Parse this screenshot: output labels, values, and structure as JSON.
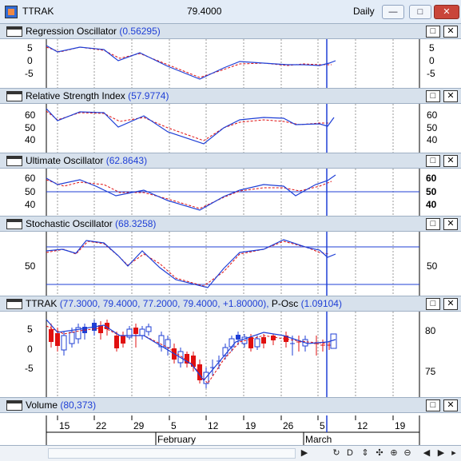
{
  "window": {
    "symbol": "TTRAK",
    "price": "79.4000",
    "period": "Daily"
  },
  "panels": {
    "regression": {
      "name": "Regression Oscillator",
      "value": "(0.56295)",
      "ticks": [
        "5",
        "0",
        "-5"
      ]
    },
    "rsi": {
      "name": "Relative Strength Index",
      "value": "(57.9774)",
      "ticks": [
        "60",
        "50",
        "40"
      ]
    },
    "ultimate": {
      "name": "Ultimate Oscillator",
      "value": "(62.8643)",
      "ticks": [
        "60",
        "50",
        "40"
      ]
    },
    "stochastic": {
      "name": "Stochastic Oscillator",
      "value": "(68.3258)",
      "ticks": [
        "50"
      ]
    },
    "price": {
      "name": "TTRAK",
      "value": "(77.3000, 79.4000, 77.2000, 79.4000, +1.80000),",
      "name2": "P-Osc",
      "value2": "(1.09104)",
      "left_ticks": [
        "5",
        "0",
        "-5"
      ],
      "right_ticks": [
        "80",
        "75"
      ]
    },
    "volume": {
      "name": "Volume",
      "value": "(80,373)"
    }
  },
  "x_axis": {
    "day_labels": [
      "15",
      "22",
      "29",
      "5",
      "12",
      "19",
      "26",
      "5",
      "12",
      "19"
    ],
    "month_labels": [
      "February",
      "March"
    ]
  },
  "colors": {
    "up": "#1f3fd6",
    "down": "#e01010",
    "accent": "#1f3fd6",
    "signal": "#e01010"
  },
  "icons": [
    "app-icon",
    "minimize-icon",
    "restore-icon",
    "close-icon",
    "panel-icon",
    "panel-maximize-icon",
    "panel-close-icon",
    "scroll-left-icon",
    "scroll-right-icon",
    "refresh-icon",
    "draw-icon",
    "hand-icon",
    "crosshair-icon",
    "zoom-in-icon",
    "zoom-out-icon"
  ]
}
